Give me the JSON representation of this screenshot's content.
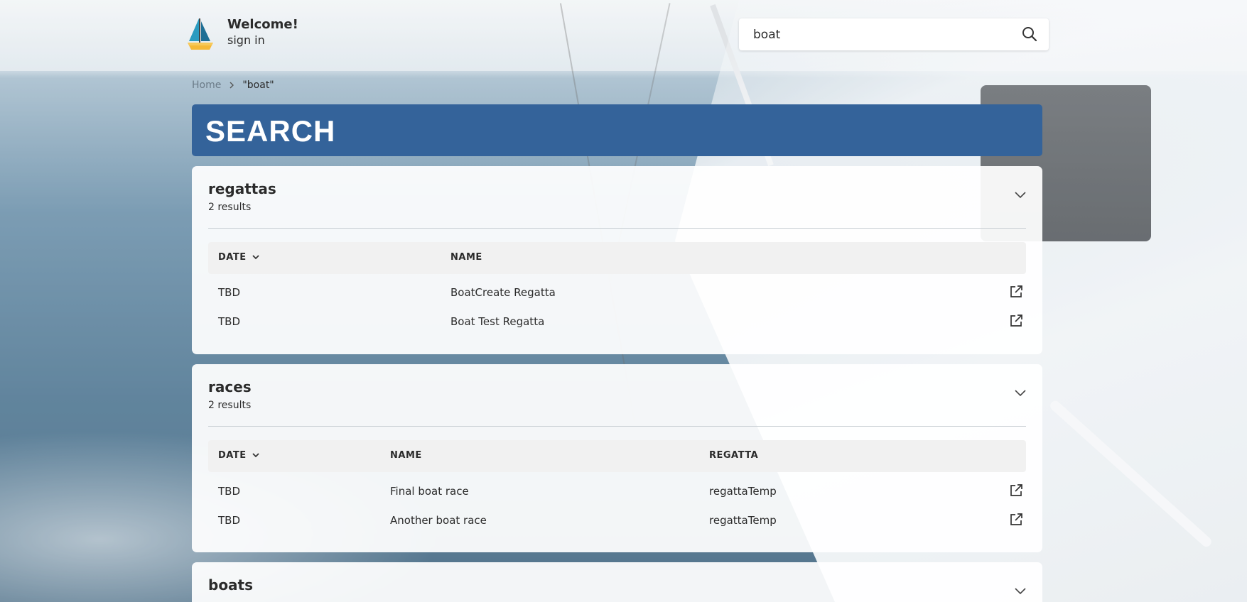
{
  "header": {
    "welcome": "Welcome!",
    "sign_in": "sign in",
    "logo_icon": "sailboat-icon"
  },
  "search": {
    "value": "boat",
    "placeholder": "",
    "icon": "search-icon"
  },
  "breadcrumb": {
    "home": "Home",
    "current": "\"boat\""
  },
  "page_title": "SEARCH",
  "colors": {
    "banner": "#34639a",
    "card_bg": "#ffffff",
    "table_header_bg": "#f1f1f1"
  },
  "sections": {
    "regattas": {
      "title": "regattas",
      "count": "2 results",
      "columns": [
        "DATE",
        "NAME"
      ],
      "rows": [
        {
          "date": "TBD",
          "name": "BoatCreate Regatta"
        },
        {
          "date": "TBD",
          "name": "Boat Test Regatta"
        }
      ]
    },
    "races": {
      "title": "races",
      "count": "2 results",
      "columns": [
        "DATE",
        "NAME",
        "REGATTA"
      ],
      "rows": [
        {
          "date": "TBD",
          "name": "Final boat race",
          "regatta": "regattaTemp"
        },
        {
          "date": "TBD",
          "name": "Another boat race",
          "regatta": "regattaTemp"
        }
      ]
    },
    "boats": {
      "title": "boats"
    }
  }
}
